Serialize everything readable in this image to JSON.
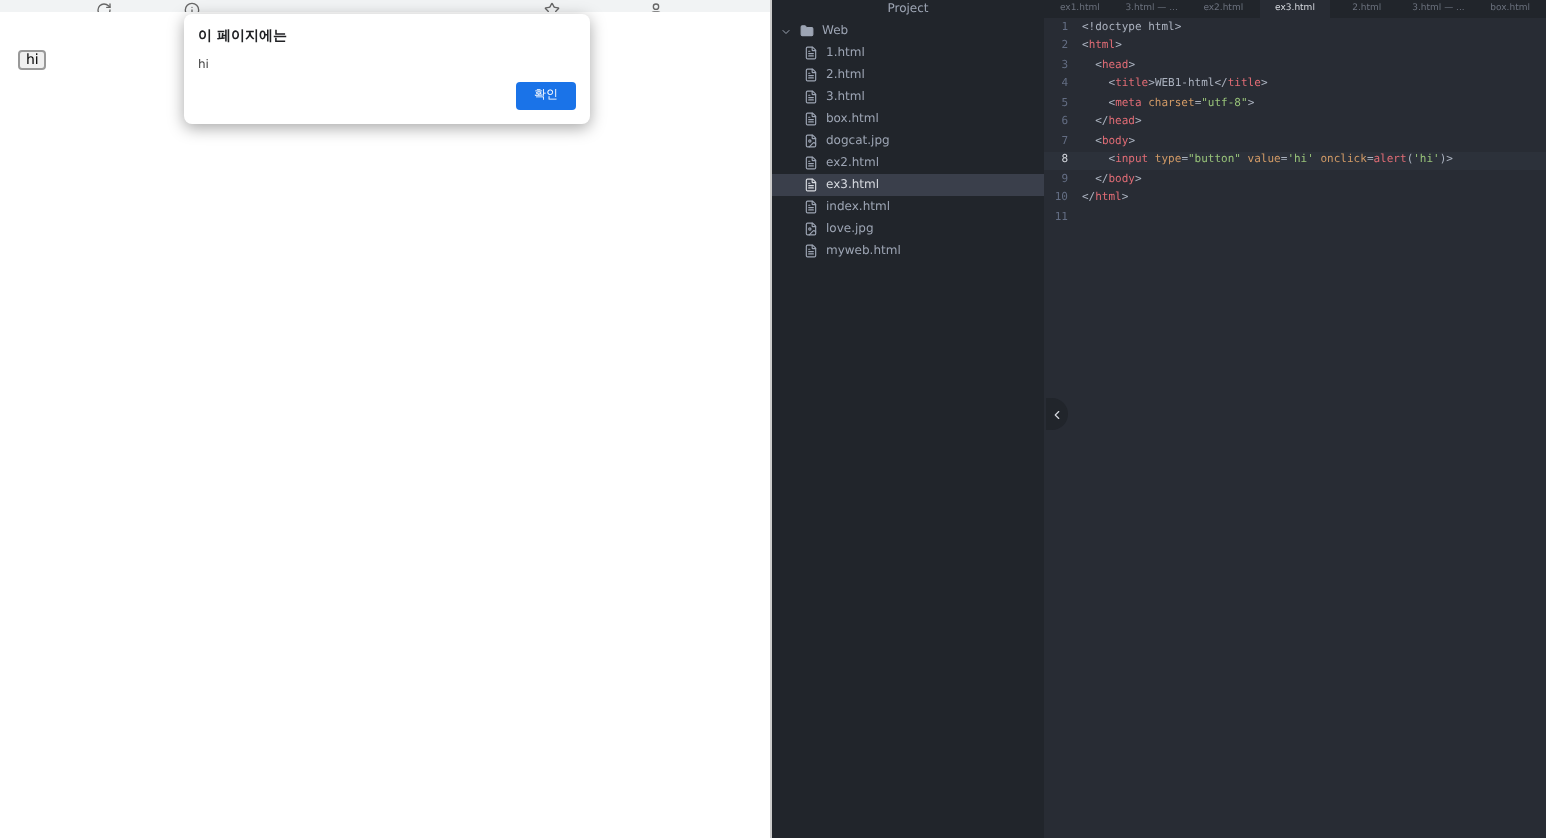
{
  "browser": {
    "page_button": "hi",
    "dialog": {
      "title": "이 페이지에는",
      "message": "hi",
      "ok": "확인"
    }
  },
  "editor": {
    "tree_title": "Project",
    "tabs": [
      {
        "label": "ex1.html",
        "selected": false
      },
      {
        "label": "3.html — ...",
        "selected": false
      },
      {
        "label": "ex2.html",
        "selected": false
      },
      {
        "label": "ex3.html",
        "selected": true
      },
      {
        "label": "2.html",
        "selected": false
      },
      {
        "label": "3.html — ...",
        "selected": false
      },
      {
        "label": "box.html",
        "selected": false
      }
    ],
    "tree": [
      {
        "label": "Web",
        "kind": "folder",
        "expanded": true,
        "selected": false,
        "children": [
          {
            "label": "1.html",
            "kind": "file",
            "selected": false
          },
          {
            "label": "2.html",
            "kind": "file",
            "selected": false
          },
          {
            "label": "3.html",
            "kind": "file",
            "selected": false
          },
          {
            "label": "box.html",
            "kind": "file",
            "selected": false
          },
          {
            "label": "dogcat.jpg",
            "kind": "image",
            "selected": false
          },
          {
            "label": "ex2.html",
            "kind": "file",
            "selected": false
          },
          {
            "label": "ex3.html",
            "kind": "file",
            "selected": true
          },
          {
            "label": "index.html",
            "kind": "file",
            "selected": false
          },
          {
            "label": "love.jpg",
            "kind": "image",
            "selected": false
          },
          {
            "label": "myweb.html",
            "kind": "file",
            "selected": false
          }
        ]
      }
    ],
    "lines": [
      {
        "number": "1",
        "current": false,
        "tokens": [
          {
            "kind": "plain",
            "text": "<!doctype html>"
          }
        ]
      },
      {
        "number": "2",
        "current": false,
        "tokens": [
          {
            "kind": "punct",
            "text": "<"
          },
          {
            "kind": "tag",
            "text": "html"
          },
          {
            "kind": "punct",
            "text": ">"
          }
        ]
      },
      {
        "number": "3",
        "current": false,
        "tokens": [
          {
            "kind": "punct",
            "text": "  <"
          },
          {
            "kind": "tag",
            "text": "head"
          },
          {
            "kind": "punct",
            "text": ">"
          }
        ]
      },
      {
        "number": "4",
        "current": false,
        "tokens": [
          {
            "kind": "punct",
            "text": "    <"
          },
          {
            "kind": "tag",
            "text": "title"
          },
          {
            "kind": "punct",
            "text": ">"
          },
          {
            "kind": "plain",
            "text": "WEB1-html"
          },
          {
            "kind": "punct",
            "text": "</"
          },
          {
            "kind": "tag",
            "text": "title"
          },
          {
            "kind": "punct",
            "text": ">"
          }
        ]
      },
      {
        "number": "5",
        "current": false,
        "tokens": [
          {
            "kind": "punct",
            "text": "    <"
          },
          {
            "kind": "tag",
            "text": "meta"
          },
          {
            "kind": "attr",
            "text": " charset"
          },
          {
            "kind": "punct",
            "text": "="
          },
          {
            "kind": "string",
            "text": "\"utf-8\""
          },
          {
            "kind": "punct",
            "text": ">"
          }
        ]
      },
      {
        "number": "6",
        "current": false,
        "tokens": [
          {
            "kind": "punct",
            "text": "  </"
          },
          {
            "kind": "tag",
            "text": "head"
          },
          {
            "kind": "punct",
            "text": ">"
          }
        ]
      },
      {
        "number": "7",
        "current": false,
        "tokens": [
          {
            "kind": "punct",
            "text": "  <"
          },
          {
            "kind": "tag",
            "text": "body"
          },
          {
            "kind": "punct",
            "text": ">"
          }
        ]
      },
      {
        "number": "8",
        "current": true,
        "tokens": [
          {
            "kind": "punct",
            "text": "    <"
          },
          {
            "kind": "tag",
            "text": "input"
          },
          {
            "kind": "attr",
            "text": " type"
          },
          {
            "kind": "punct",
            "text": "="
          },
          {
            "kind": "string",
            "text": "\"button\""
          },
          {
            "kind": "attr",
            "text": " value"
          },
          {
            "kind": "punct",
            "text": "="
          },
          {
            "kind": "string",
            "text": "'hi'"
          },
          {
            "kind": "attr",
            "text": " onclick"
          },
          {
            "kind": "punct",
            "text": "="
          },
          {
            "kind": "tag",
            "text": "alert"
          },
          {
            "kind": "punct",
            "text": "("
          },
          {
            "kind": "string",
            "text": "'hi'"
          },
          {
            "kind": "punct",
            "text": ")>"
          }
        ]
      },
      {
        "number": "9",
        "current": false,
        "tokens": [
          {
            "kind": "punct",
            "text": "  </"
          },
          {
            "kind": "tag",
            "text": "body"
          },
          {
            "kind": "punct",
            "text": ">"
          }
        ]
      },
      {
        "number": "10",
        "current": false,
        "tokens": [
          {
            "kind": "punct",
            "text": "</"
          },
          {
            "kind": "tag",
            "text": "html"
          },
          {
            "kind": "punct",
            "text": ">"
          }
        ]
      },
      {
        "number": "11",
        "current": false
      }
    ]
  }
}
